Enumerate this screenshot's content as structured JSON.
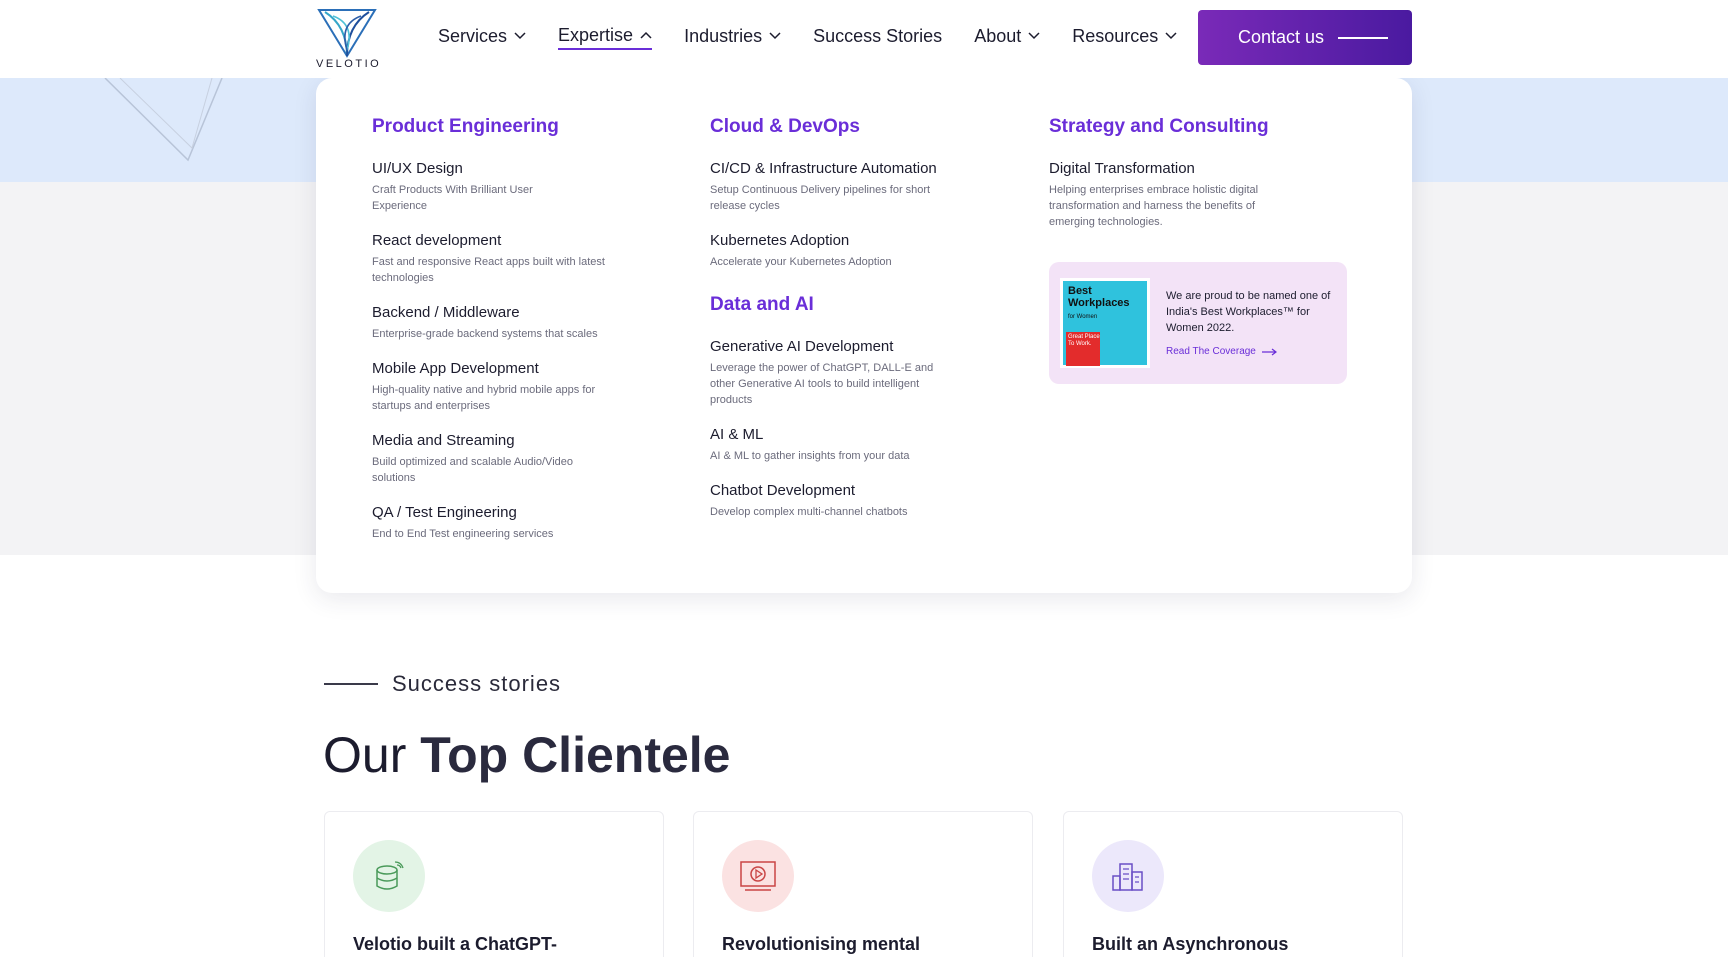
{
  "brand": {
    "name": "VELOTIO",
    "accent": "#6a2ed8"
  },
  "nav": {
    "items": [
      {
        "label": "Services",
        "has_chevron": true,
        "chevron": "down"
      },
      {
        "label": "Expertise",
        "has_chevron": true,
        "chevron": "up",
        "active": true
      },
      {
        "label": "Industries",
        "has_chevron": true,
        "chevron": "down"
      },
      {
        "label": "Success Stories",
        "has_chevron": false
      },
      {
        "label": "About",
        "has_chevron": true,
        "chevron": "down"
      },
      {
        "label": "Resources",
        "has_chevron": true,
        "chevron": "down"
      }
    ],
    "contact_label": "Contact us"
  },
  "dropdown": {
    "col1": {
      "title": "Product Engineering",
      "items": [
        {
          "title": "UI/UX Design",
          "desc": "Craft Products With Brilliant User Experience"
        },
        {
          "title": "React development",
          "desc": "Fast and responsive React apps built with latest technologies"
        },
        {
          "title": "Backend / Middleware",
          "desc": "Enterprise-grade backend systems that scales"
        },
        {
          "title": "Mobile App Development",
          "desc": "High-quality native and hybrid mobile apps for startups and enterprises"
        },
        {
          "title": "Media and Streaming",
          "desc": "Build optimized and scalable Audio/Video solutions"
        },
        {
          "title": "QA / Test Engineering",
          "desc": "End to End Test engineering services"
        }
      ]
    },
    "col2": {
      "title": "Cloud & DevOps",
      "items": [
        {
          "title": "CI/CD & Infrastructure Automation",
          "desc": "Setup Continuous Delivery pipelines for short release cycles"
        },
        {
          "title": "Kubernetes Adoption",
          "desc": "Accelerate your Kubernetes Adoption"
        }
      ],
      "sub_title": "Data and AI",
      "sub_items": [
        {
          "title": "Generative AI Development",
          "desc": "Leverage the power of ChatGPT, DALL-E and other Generative AI tools to build intelligent products"
        },
        {
          "title": "AI & ML",
          "desc": "AI & ML to gather insights from your data"
        },
        {
          "title": "Chatbot Development",
          "desc": "Develop complex multi-channel chatbots"
        }
      ]
    },
    "col3": {
      "title": "Strategy and Consulting",
      "items": [
        {
          "title": "Digital Transformation",
          "desc": "Helping enterprises embrace holistic digital transformation and harness the benefits of emerging technologies."
        }
      ],
      "award": {
        "badge_title": "Best Workplaces",
        "badge_sub": "for Women",
        "badge_red": "Great Place To Work.",
        "text": "We are proud to be named one of India's Best Workplaces™ for Women 2022.",
        "link": "Read The Coverage"
      }
    }
  },
  "stories": {
    "label": "Success stories",
    "headline_light": "Our",
    "headline_bold": "Top Clientele",
    "cards": [
      {
        "title": "Velotio built a ChatGPT-",
        "icon": "database-wifi-icon",
        "bg": "#e3f4e6"
      },
      {
        "title": "Revolutionising mental",
        "icon": "video-play-icon",
        "bg": "#fbe2e2"
      },
      {
        "title": "Built an Asynchronous",
        "icon": "buildings-icon",
        "bg": "#ece8fb"
      }
    ]
  }
}
